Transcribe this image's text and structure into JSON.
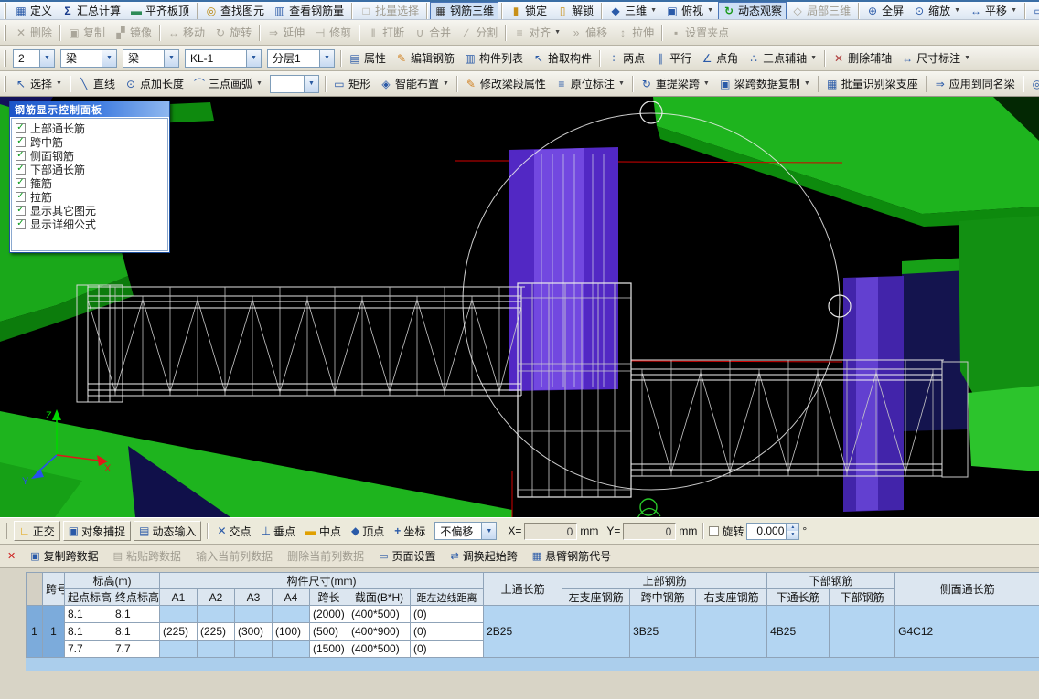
{
  "colors": {
    "viewport_bg": "#000000",
    "slab_green": "#1eb41e",
    "column_purple": "#5228c4",
    "selection_blue": "#b3d5f2",
    "accent_blue": "#2a5aa8"
  },
  "icons": {
    "define": "▦",
    "sigma": "Σ",
    "flushtop": "▬",
    "find": "◎",
    "rebaramount": "▥",
    "batchsel": "□",
    "rebar3d": "▦",
    "lock": "▮",
    "unlock": "▯",
    "cube": "◆",
    "topview": "▣",
    "orbit": "↻",
    "partial3d": "◇",
    "fullscreen": "⊕",
    "zoom": "⊙",
    "pan": "↔",
    "screen": "▭",
    "del": "✕",
    "copy": "▣",
    "mirror": "▞",
    "move": "↔",
    "rot": "↻",
    "extend": "⇒",
    "trim": "⊣",
    "brk": "‖",
    "merge": "∪",
    "split": "∕",
    "align": "≡",
    "offset": "»",
    "stretch": "↕",
    "grip": "▪",
    "prop": "▤",
    "pencil": "✎",
    "complist": "▥",
    "pick": "↖",
    "twopoint": "∶",
    "parallel": "∥",
    "angle": "∠",
    "threeaxis": "∴",
    "delaxis": "✕",
    "dim": "↔",
    "cursor": "↖",
    "lineic": "╲",
    "pointlen": "⊙",
    "arc": "⌒",
    "rectic": "▭",
    "smart": "◈",
    "modify": "✎",
    "insitu": "≡",
    "respan": "↻",
    "spancopy": "▣",
    "identify": "▦",
    "apply": "⇒",
    "search": "◎",
    "ortho": "∟",
    "osnap": "▣",
    "dyninput": "▤",
    "inter": "✕",
    "perp": "⊥",
    "mid": "▬",
    "vertex": "◆",
    "coord": "+",
    "copydata": "▣",
    "pastedata": "▤",
    "pagesetup": "▭",
    "swap": "⇄",
    "cantilever": "▦",
    "dd": "▼",
    "check": "✓",
    "close": "✕"
  },
  "toolbar_top": {
    "items": [
      "定义",
      "汇总计算",
      "平齐板顶",
      "查找图元",
      "查看钢筋量",
      "批量选择",
      "钢筋三维",
      "锁定",
      "解锁",
      "三维",
      "俯视",
      "动态观察",
      "局部三维",
      "全屏",
      "缩放",
      "平移",
      "屏幕"
    ]
  },
  "toolbar_edit": {
    "items": [
      "删除",
      "复制",
      "镜像",
      "移动",
      "旋转",
      "延伸",
      "修剪",
      "打断",
      "合并",
      "分割",
      "对齐",
      "偏移",
      "拉伸",
      "设置夹点"
    ]
  },
  "toolbar_component": {
    "combos": {
      "floor": "2",
      "category": "梁",
      "type": "梁",
      "name": "KL-1",
      "layer": "分层1"
    },
    "buttons": [
      "属性",
      "编辑钢筋",
      "构件列表",
      "拾取构件",
      "两点",
      "平行",
      "点角",
      "三点辅轴",
      "删除辅轴",
      "尺寸标注"
    ]
  },
  "toolbar_draw": {
    "items": [
      "选择",
      "直线",
      "点加长度",
      "三点画弧",
      "矩形",
      "智能布置",
      "修改梁段属性",
      "原位标注",
      "重提梁跨",
      "梁跨数据复制",
      "批量识别梁支座",
      "应用到同名梁",
      "查"
    ]
  },
  "rebar_panel": {
    "title": "钢筋显示控制面板",
    "items": [
      {
        "label": "上部通长筋",
        "checked": true
      },
      {
        "label": "跨中筋",
        "checked": true
      },
      {
        "label": "侧面钢筋",
        "checked": true
      },
      {
        "label": "下部通长筋",
        "checked": true
      },
      {
        "label": "箍筋",
        "checked": true
      },
      {
        "label": "拉筋",
        "checked": true
      },
      {
        "label": "显示其它图元",
        "checked": true
      },
      {
        "label": "显示详细公式",
        "checked": true
      }
    ]
  },
  "viewport": {
    "axis": {
      "x": "X",
      "y": "Y",
      "z": "Z"
    }
  },
  "snap_bar": {
    "ortho": "正交",
    "object_snap": "对象捕捉",
    "dynamic_input": "动态输入",
    "intersection": "交点",
    "perpendicular": "垂点",
    "midpoint": "中点",
    "vertex": "顶点",
    "coordinate": "坐标",
    "offset_combo": "不偏移",
    "x_label": "X=",
    "x_value": "0",
    "x_unit": "mm",
    "y_label": "Y=",
    "y_value": "0",
    "y_unit": "mm",
    "rotate_label": "旋转",
    "rotate_value": "0.000",
    "rotate_unit": "°"
  },
  "span_actions": {
    "items": [
      "复制跨数据",
      "粘贴跨数据",
      "输入当前列数据",
      "删除当前列数据",
      "页面设置",
      "调换起始跨",
      "悬臂钢筋代号"
    ]
  },
  "span_table": {
    "headers": {
      "span_no": "跨号",
      "elevation": "标高(m)",
      "start_elev": "起点标高",
      "end_elev": "终点标高",
      "size_group": "构件尺寸(mm)",
      "a1": "A1",
      "a2": "A2",
      "a3": "A3",
      "a4": "A4",
      "span_len": "跨长",
      "section": "截面(B*H)",
      "left_dist": "距左边线距离",
      "top_through": "上通长筋",
      "top_group": "上部钢筋",
      "left_support": "左支座钢筋",
      "mid_span": "跨中钢筋",
      "right_support": "右支座钢筋",
      "bottom_group": "下部钢筋",
      "bottom_through": "下通长筋",
      "bottom_rebar": "下部钢筋",
      "side_through": "侧面通长筋"
    },
    "row_index": "1",
    "span_no": "1",
    "sub_rows": [
      {
        "start": "8.1",
        "end": "8.1",
        "a1": "",
        "a2": "",
        "a3": "",
        "a4": "",
        "len": "(2000)",
        "section": "(400*500)",
        "dist": "(0)"
      },
      {
        "start": "8.1",
        "end": "8.1",
        "a1": "(225)",
        "a2": "(225)",
        "a3": "(300)",
        "a4": "(100)",
        "len": "(500)",
        "section": "(400*900)",
        "dist": "(0)"
      },
      {
        "start": "7.7",
        "end": "7.7",
        "a1": "",
        "a2": "",
        "a3": "",
        "a4": "",
        "len": "(1500)",
        "section": "(400*500)",
        "dist": "(0)"
      }
    ],
    "top_through": "2B25",
    "left_support": "",
    "mid_span": "3B25",
    "right_support": "",
    "bottom_through": "4B25",
    "bottom_rebar": "",
    "side_through": "G4C12"
  }
}
